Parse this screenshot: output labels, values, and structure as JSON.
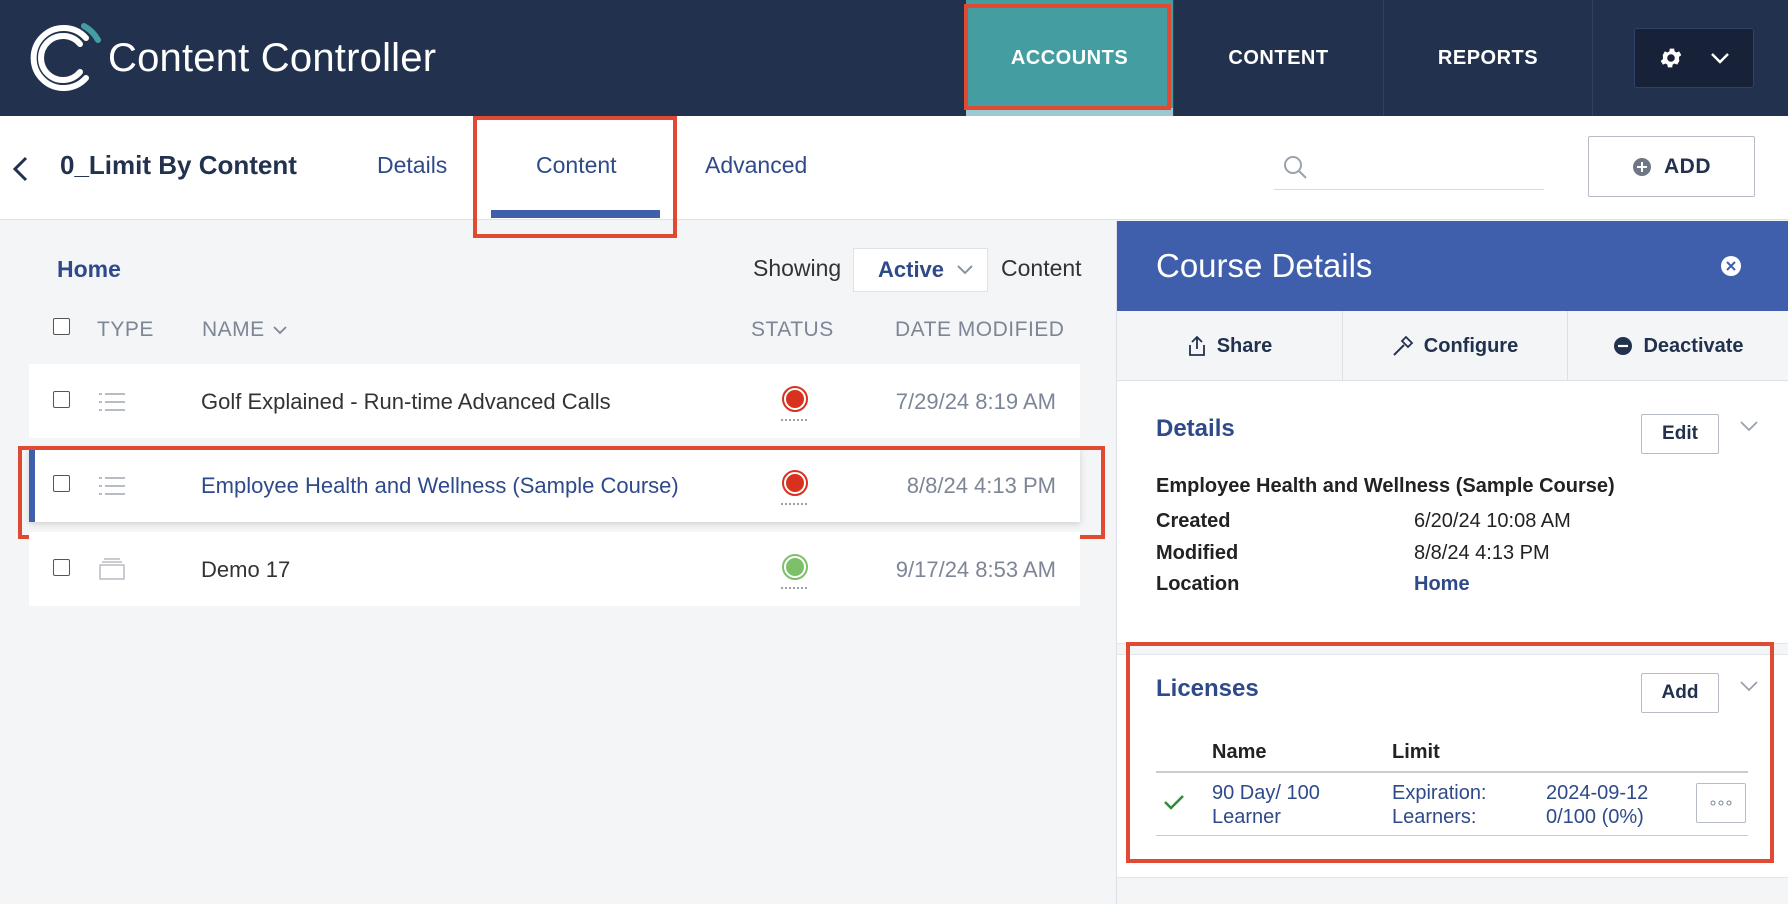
{
  "app": {
    "title": "Content Controller"
  },
  "nav": {
    "accounts": "ACCOUNTS",
    "content": "CONTENT",
    "reports": "REPORTS"
  },
  "account": {
    "title": "0_Limit By Content"
  },
  "tabs": {
    "details": "Details",
    "content": "Content",
    "advanced": "Advanced"
  },
  "search": {
    "placeholder": ""
  },
  "toolbar": {
    "add_label": "ADD"
  },
  "breadcrumb": {
    "home": "Home"
  },
  "filter": {
    "prefix": "Showing",
    "selected": "Active",
    "suffix": "Content"
  },
  "table": {
    "headers": {
      "type": "TYPE",
      "name": "NAME",
      "status": "STATUS",
      "date": "DATE MODIFIED"
    },
    "rows": [
      {
        "type": "course-list",
        "name": "Golf Explained - Run-time Advanced Calls",
        "status": "inactive",
        "date": "7/29/24 8:19 AM"
      },
      {
        "type": "course-list",
        "name": "Employee Health and Wellness (Sample Course)",
        "status": "inactive",
        "date": "8/8/24 4:13 PM",
        "selected": true
      },
      {
        "type": "folder-stack",
        "name": "Demo 17",
        "status": "active",
        "date": "9/17/24 8:53 AM"
      }
    ]
  },
  "colors": {
    "header_bg": "#22324e",
    "accent": "#3f5eab",
    "nav_active": "#439da1",
    "status_red": "#d8321f",
    "status_green": "#7cc16a",
    "highlight": "#e04a33"
  },
  "panel": {
    "title": "Course Details",
    "actions": {
      "share": "Share",
      "configure": "Configure",
      "deactivate": "Deactivate"
    },
    "details": {
      "title": "Details",
      "edit_label": "Edit",
      "name": "Employee Health and Wellness (Sample Course)",
      "fields": [
        {
          "label": "Created",
          "value": "6/20/24 10:08 AM"
        },
        {
          "label": "Modified",
          "value": "8/8/24 4:13 PM"
        },
        {
          "label": "Location",
          "value": "Home"
        }
      ]
    },
    "licenses": {
      "title": "Licenses",
      "add_label": "Add",
      "headers": {
        "name": "Name",
        "limit": "Limit"
      },
      "rows": [
        {
          "name_line1": "90 Day/ 100",
          "name_line2": "Learner",
          "limit_label1": "Expiration:",
          "limit_label2": "Learners:",
          "limit_value1": "2024-09-12",
          "limit_value2": "0/100 (0%)"
        }
      ]
    }
  }
}
